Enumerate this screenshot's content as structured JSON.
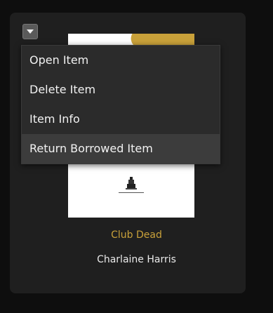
{
  "book": {
    "title": "Club Dead",
    "author": "Charlaine Harris"
  },
  "menu": {
    "items": [
      {
        "label": "Open Item"
      },
      {
        "label": "Delete Item"
      },
      {
        "label": "Item Info"
      },
      {
        "label": "Return Borrowed Item"
      }
    ]
  },
  "colors": {
    "title_accent": "#c9a13a",
    "menu_background": "#2b2b2b",
    "menu_highlight": "#3c3c3c",
    "tile_background": "#1f1f1f"
  },
  "icons": {
    "menu_toggle": "chevron-down-icon"
  }
}
